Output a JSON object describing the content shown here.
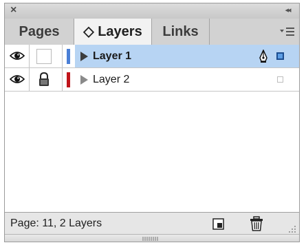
{
  "titlebar": {
    "close_icon": "close-icon",
    "collapse_icon": "double-chevron-right-icon"
  },
  "tabs": [
    {
      "label": "Pages",
      "active": false
    },
    {
      "label": "◇ Layers",
      "active": true
    },
    {
      "label": "Links",
      "active": false
    }
  ],
  "panel_menu_icon": "panel-menu-icon",
  "layers": [
    {
      "name": "Layer 1",
      "visible": true,
      "locked": false,
      "color": "#4a7fd6",
      "selected": true,
      "target_icon": "pen-nib-icon",
      "selection_square": "filled"
    },
    {
      "name": "Layer 2",
      "visible": true,
      "locked": true,
      "color": "#c0141a",
      "selected": false,
      "selection_square": "empty"
    }
  ],
  "status": {
    "text": "Page: 11, 2 Layers",
    "new_layer_icon": "new-layer-icon",
    "delete_icon": "trash-icon"
  },
  "colors": {
    "selection_bg": "#b7d4f3",
    "panel_bg": "#e3e3e3"
  }
}
